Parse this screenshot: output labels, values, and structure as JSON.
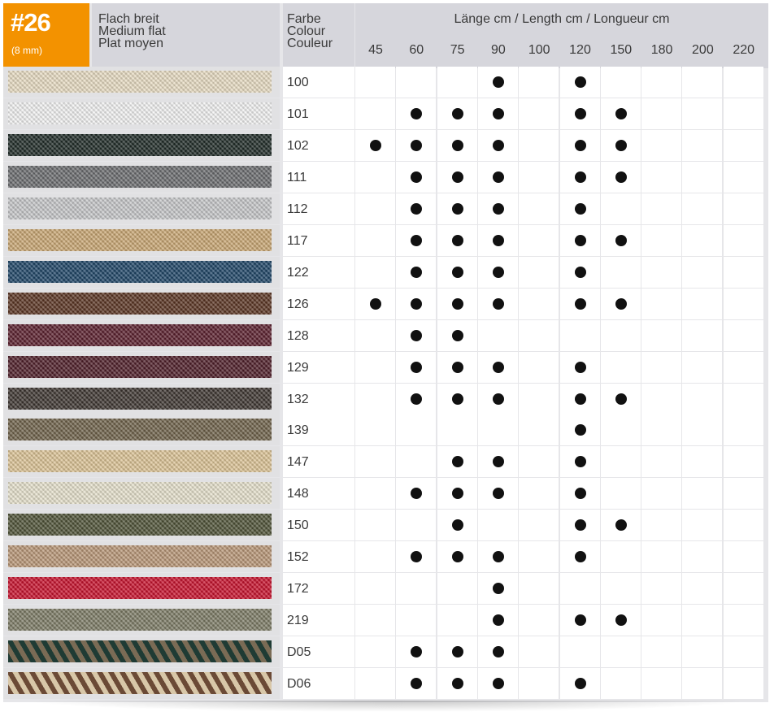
{
  "product": {
    "number": "#26",
    "width": "(8 mm)",
    "type_de": "Flach breit",
    "type_en": "Medium flat",
    "type_fr": "Plat moyen"
  },
  "header": {
    "color_de": "Farbe",
    "color_en": "Colour",
    "color_fr": "Couleur",
    "length_title": "Länge cm / Length cm / Longueur cm",
    "lengths": [
      "45",
      "60",
      "75",
      "90",
      "100",
      "120",
      "150",
      "180",
      "200",
      "220"
    ]
  },
  "colors": {
    "badge": "#f39200",
    "header_bg": "#d6d6dc",
    "dot": "#111111"
  },
  "rows": [
    {
      "code": "100",
      "swatch": "#e8dcc2",
      "available": [
        "90",
        "120"
      ]
    },
    {
      "code": "101",
      "swatch": "#f2f2f2",
      "available": [
        "60",
        "75",
        "90",
        "120",
        "150"
      ]
    },
    {
      "code": "102",
      "swatch": "#1e2a26",
      "available": [
        "45",
        "60",
        "75",
        "90",
        "120",
        "150"
      ]
    },
    {
      "code": "111",
      "swatch": "#6a6b6e",
      "available": [
        "60",
        "75",
        "90",
        "120",
        "150"
      ]
    },
    {
      "code": "112",
      "swatch": "#c6c7c9",
      "available": [
        "60",
        "75",
        "90",
        "120"
      ]
    },
    {
      "code": "117",
      "swatch": "#c9a672",
      "available": [
        "60",
        "75",
        "90",
        "120",
        "150"
      ]
    },
    {
      "code": "122",
      "swatch": "#1d4466",
      "available": [
        "60",
        "75",
        "90",
        "120"
      ]
    },
    {
      "code": "126",
      "swatch": "#5a3422",
      "available": [
        "45",
        "60",
        "75",
        "90",
        "120",
        "150"
      ]
    },
    {
      "code": "128",
      "swatch": "#5a1e2c",
      "available": [
        "60",
        "75"
      ]
    },
    {
      "code": "129",
      "swatch": "#4e1d28",
      "available": [
        "60",
        "75",
        "90",
        "120"
      ]
    },
    {
      "code": "132",
      "swatch": "#3d3530",
      "available": [
        "60",
        "75",
        "90",
        "120",
        "150"
      ]
    },
    {
      "code": "139",
      "swatch": "#6e6149",
      "available": [
        "120"
      ]
    },
    {
      "code": "147",
      "swatch": "#dcc395",
      "available": [
        "75",
        "90",
        "120"
      ]
    },
    {
      "code": "148",
      "swatch": "#e6e1cc",
      "available": [
        "60",
        "75",
        "90",
        "120"
      ]
    },
    {
      "code": "150",
      "swatch": "#4e5236",
      "available": [
        "75",
        "120",
        "150"
      ]
    },
    {
      "code": "152",
      "swatch": "#b89676",
      "available": [
        "60",
        "75",
        "90",
        "120"
      ]
    },
    {
      "code": "172",
      "swatch": "#c8102b",
      "available": [
        "90"
      ]
    },
    {
      "code": "219",
      "swatch": "#7c7a64",
      "available": [
        "90",
        "120",
        "150"
      ]
    },
    {
      "code": "D05",
      "swatch": "#1f3b34",
      "swatch2": "#7a6b55",
      "available": [
        "60",
        "75",
        "90"
      ]
    },
    {
      "code": "D06",
      "swatch": "#6b4a36",
      "swatch2": "#d8c7a8",
      "available": [
        "60",
        "75",
        "90",
        "120"
      ]
    }
  ]
}
